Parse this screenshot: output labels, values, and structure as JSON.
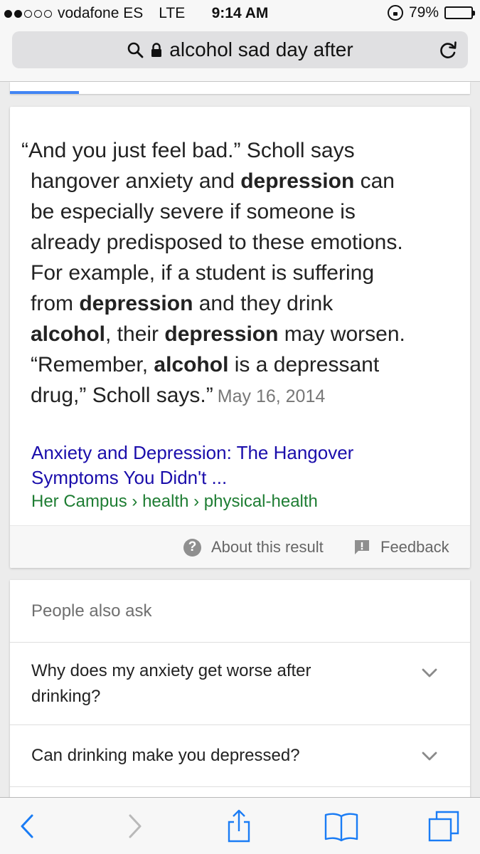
{
  "status_bar": {
    "carrier": "vodafone ES",
    "network": "LTE",
    "time": "9:14 AM",
    "battery_percent": "79%",
    "battery_level": 0.79,
    "signal_bars_filled": 2,
    "signal_bars_total": 5
  },
  "browser": {
    "address_text": "alcohol sad day after"
  },
  "result": {
    "snippet_lines": [
      {
        "segments": [
          {
            "t": "“And you just feel bad.” Scholl says"
          }
        ]
      },
      {
        "segments": [
          {
            "t": "hangover anxiety and "
          },
          {
            "t": "depression",
            "b": true
          },
          {
            "t": " can"
          }
        ]
      },
      {
        "segments": [
          {
            "t": "be especially severe if someone is"
          }
        ]
      },
      {
        "segments": [
          {
            "t": "already predisposed to these emotions."
          }
        ]
      },
      {
        "segments": [
          {
            "t": "For example, if a student is suffering"
          }
        ]
      },
      {
        "segments": [
          {
            "t": "from "
          },
          {
            "t": "depression",
            "b": true
          },
          {
            "t": " and they drink"
          }
        ]
      },
      {
        "segments": [
          {
            "t": "alcohol",
            "b": true
          },
          {
            "t": ", their "
          },
          {
            "t": "depression",
            "b": true
          },
          {
            "t": " may worsen."
          }
        ]
      },
      {
        "segments": [
          {
            "t": "“Remember, "
          },
          {
            "t": "alcohol",
            "b": true
          },
          {
            "t": " is a depressant"
          }
        ]
      },
      {
        "segments": [
          {
            "t": "drug,” Scholl says.”"
          }
        ]
      }
    ],
    "date": "May 16, 2014",
    "title_line_1": "Anxiety and Depression: The Hangover",
    "title_line_2": "Symptoms You Didn't ...",
    "url_site": "Her Campus",
    "url_path_1": "health",
    "url_path_2": "physical-health",
    "url_separator": "›",
    "about_label": "About this result",
    "feedback_label": "Feedback",
    "link_color": "#1a0dab",
    "url_color": "#1e7d33"
  },
  "people_also_ask": {
    "heading": "People also ask",
    "questions": [
      {
        "line_1": "Why does my anxiety get worse after",
        "line_2": "drinking?"
      },
      {
        "line_1": "Can drinking make you depressed?",
        "line_2": ""
      }
    ]
  },
  "toolbar": {
    "icons": [
      "back-icon",
      "forward-icon",
      "share-icon",
      "bookmarks-icon",
      "tabs-icon"
    ],
    "accent": "#1a7cf5"
  }
}
